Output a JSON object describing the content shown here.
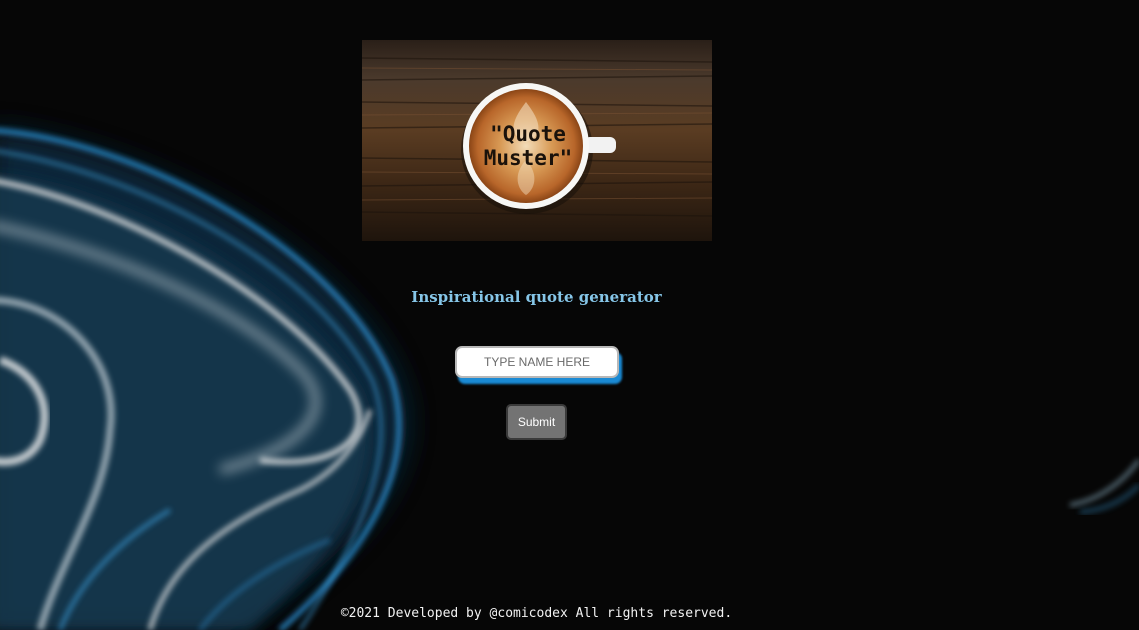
{
  "logo": {
    "text_line1": "\"Quote",
    "text_line2": "Muster\""
  },
  "tagline": "Inspirational quote generator",
  "form": {
    "name_placeholder": "TYPE NAME HERE",
    "name_value": "",
    "submit_label": "Submit"
  },
  "footer": {
    "text": "©2021 Developed by @comicodex All rights reserved."
  },
  "colors": {
    "background": "#060606",
    "tagline": "#86c6e8",
    "input_shadow": "#1a8ad4",
    "button": "#737373"
  }
}
